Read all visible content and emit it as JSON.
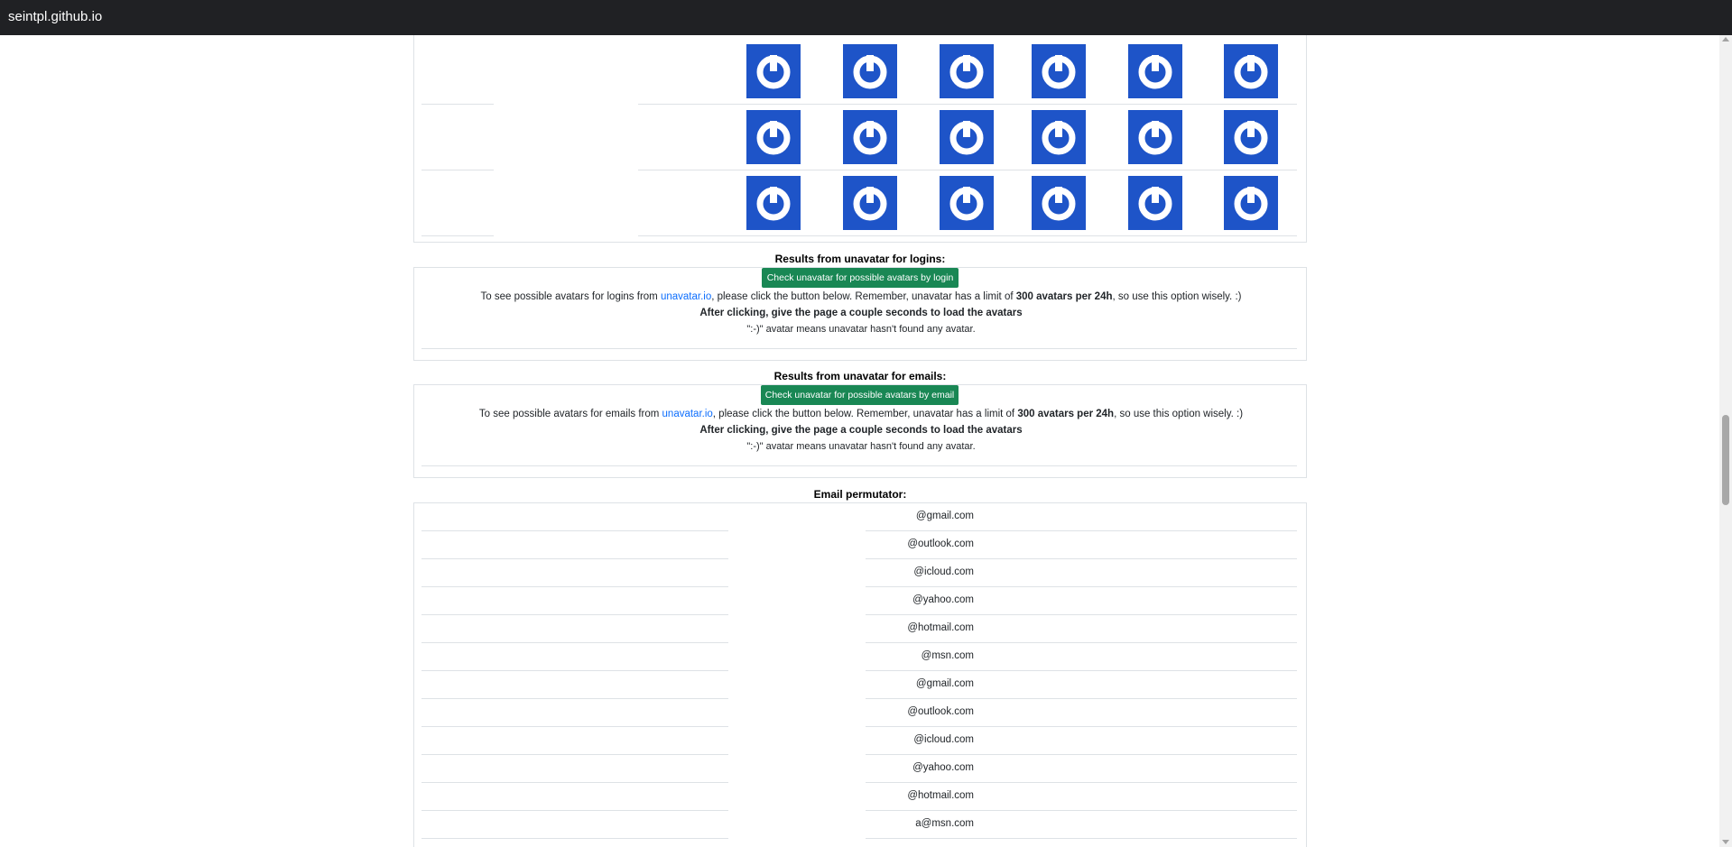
{
  "browser": {
    "site": "seintpl.github.io"
  },
  "avatar_grid": {
    "icon": "gravatar-power-icon",
    "color": "#1e54c8",
    "rows": 3,
    "columns": 6
  },
  "unavatar_logins": {
    "title": "Results from unavatar for logins:",
    "button_label": "Check unavatar for possible avatars by login",
    "text_before": "To see possible avatars for logins from ",
    "link_text": "unavatar.io",
    "text_mid": ", please click the button below. Remember, unavatar has a limit of ",
    "limit_text": "300 avatars per 24h",
    "text_after": ", so use this option wisely. :)",
    "note_bold": "After clicking, give the page a couple seconds to load the avatars",
    "note": "\":-)\" avatar means unavatar hasn't found any avatar."
  },
  "unavatar_emails": {
    "title": "Results from unavatar for emails:",
    "button_label": "Check unavatar for possible avatars by email",
    "text_before": "To see possible avatars for emails from ",
    "link_text": "unavatar.io",
    "text_mid": ", please click the button below. Remember, unavatar has a limit of ",
    "limit_text": "300 avatars per 24h",
    "text_after": ", so use this option wisely. :)",
    "note_bold": "After clicking, give the page a couple seconds to load the avatars",
    "note": "\":-)\" avatar means unavatar hasn't found any avatar."
  },
  "email_permutator": {
    "title": "Email permutator:",
    "emails": [
      "@gmail.com",
      "@outlook.com",
      "@icloud.com",
      "@yahoo.com",
      "@hotmail.com",
      "@msn.com",
      "@gmail.com",
      "@outlook.com",
      "@icloud.com",
      "@yahoo.com",
      "@hotmail.com",
      "a@msn.com"
    ]
  },
  "colors": {
    "button_green": "#198754",
    "link_blue": "#0d6efd",
    "topbar": "#202124"
  }
}
